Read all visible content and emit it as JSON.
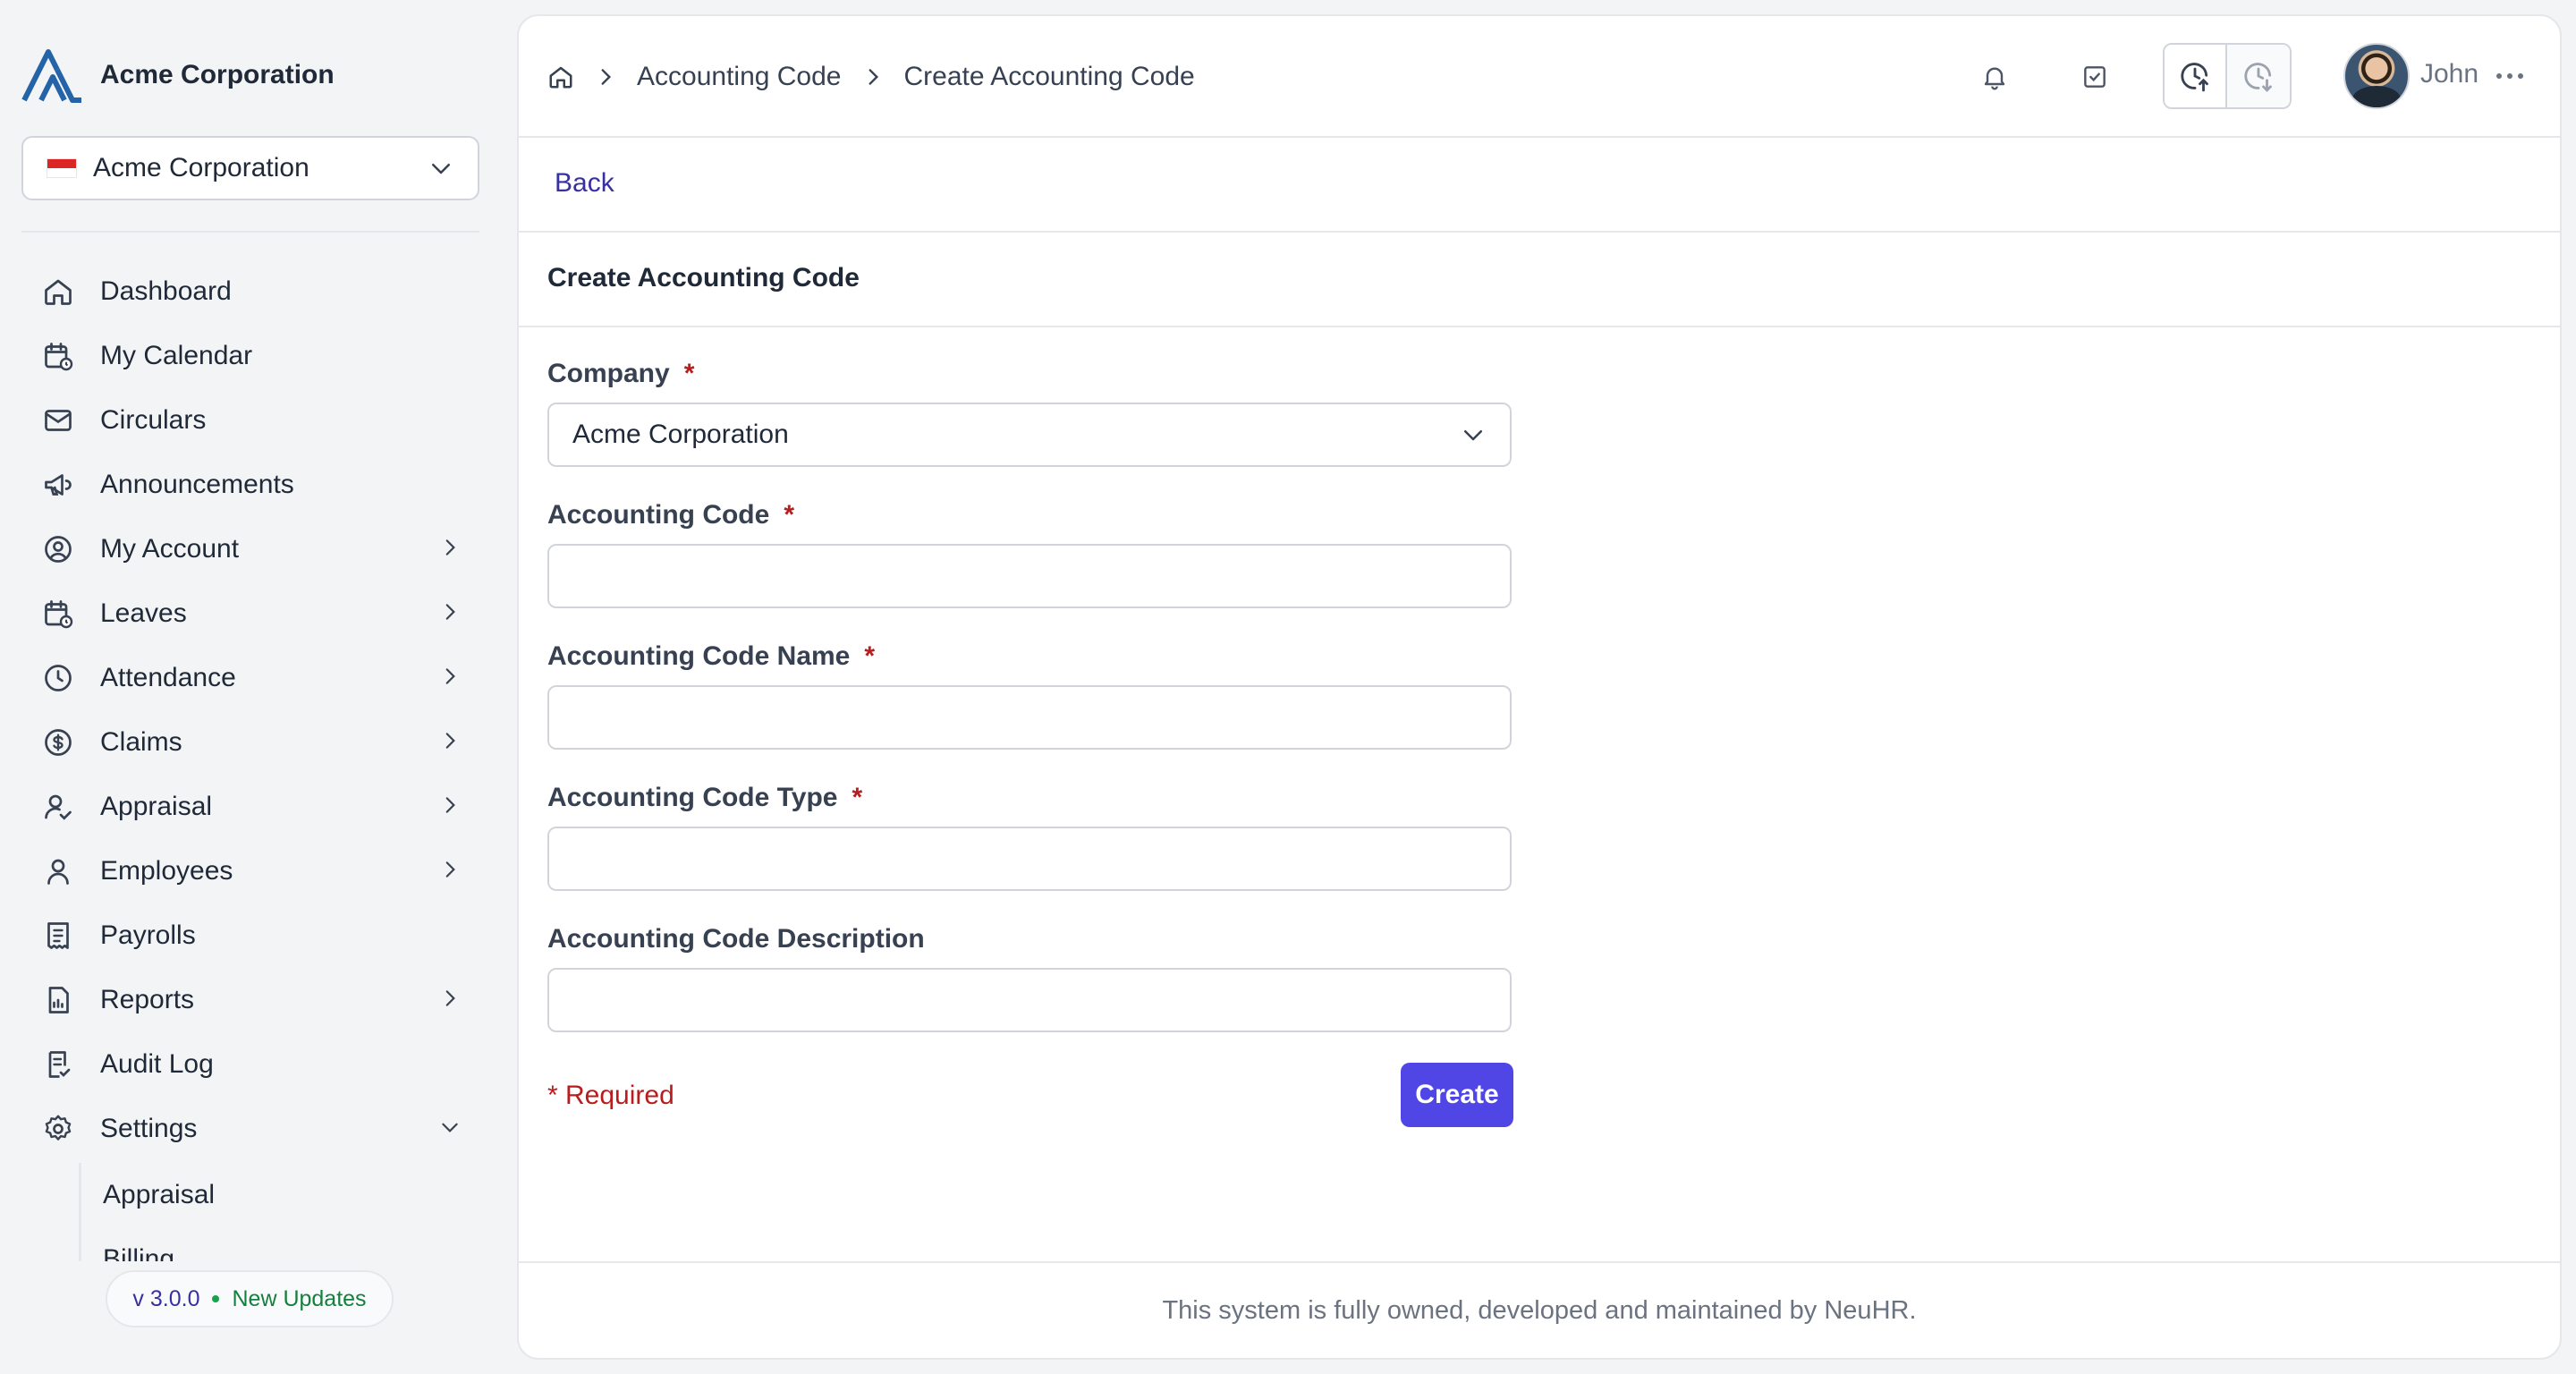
{
  "brand": {
    "name": "Acme Corporation"
  },
  "company_selector": {
    "value": "Acme Corporation",
    "icon": "flag-icon"
  },
  "nav": [
    {
      "label": "Dashboard",
      "icon": "home-icon",
      "has_children": false
    },
    {
      "label": "My Calendar",
      "icon": "calendar-icon",
      "has_children": false
    },
    {
      "label": "Circulars",
      "icon": "mail-icon",
      "has_children": false
    },
    {
      "label": "Announcements",
      "icon": "megaphone-icon",
      "has_children": false
    },
    {
      "label": "My Account",
      "icon": "user-circle-icon",
      "has_children": true
    },
    {
      "label": "Leaves",
      "icon": "calendar-clock-icon",
      "has_children": true
    },
    {
      "label": "Attendance",
      "icon": "clock-icon",
      "has_children": true
    },
    {
      "label": "Claims",
      "icon": "dollar-circle-icon",
      "has_children": true
    },
    {
      "label": "Appraisal",
      "icon": "user-check-icon",
      "has_children": true
    },
    {
      "label": "Employees",
      "icon": "user-icon",
      "has_children": true
    },
    {
      "label": "Payrolls",
      "icon": "receipt-icon",
      "has_children": false
    },
    {
      "label": "Reports",
      "icon": "report-icon",
      "has_children": true
    },
    {
      "label": "Audit Log",
      "icon": "audit-icon",
      "has_children": false
    },
    {
      "label": "Settings",
      "icon": "gear-icon",
      "has_children": true,
      "expanded": true
    }
  ],
  "settings_sub": [
    "Appraisal",
    "Billing"
  ],
  "version": {
    "number": "v 3.0.0",
    "updates": "New Updates"
  },
  "breadcrumb": {
    "home_icon": "home-icon",
    "items": [
      "Accounting Code",
      "Create Accounting Code"
    ]
  },
  "header": {
    "user_name": "John",
    "icons": [
      "bell-icon",
      "checkbox-icon",
      "clock-in-icon",
      "clock-out-icon",
      "more-icon"
    ]
  },
  "page": {
    "back": "Back",
    "title": "Create Accounting Code"
  },
  "form": {
    "company": {
      "label": "Company",
      "value": "Acme Corporation",
      "required": "*"
    },
    "code": {
      "label": "Accounting Code",
      "value": "",
      "required": "*"
    },
    "name": {
      "label": "Accounting Code Name",
      "value": "",
      "required": "*"
    },
    "type": {
      "label": "Accounting Code Type",
      "value": "",
      "required": "*"
    },
    "description": {
      "label": "Accounting Code Description",
      "value": ""
    },
    "required_note": "* Required",
    "submit": "Create"
  },
  "footer": {
    "text": "This system is fully owned, developed and maintained by NeuHR."
  },
  "colors": {
    "accent": "#4f46e5",
    "link": "#3730a3",
    "required": "#b91c1c",
    "success": "#16a34a"
  }
}
